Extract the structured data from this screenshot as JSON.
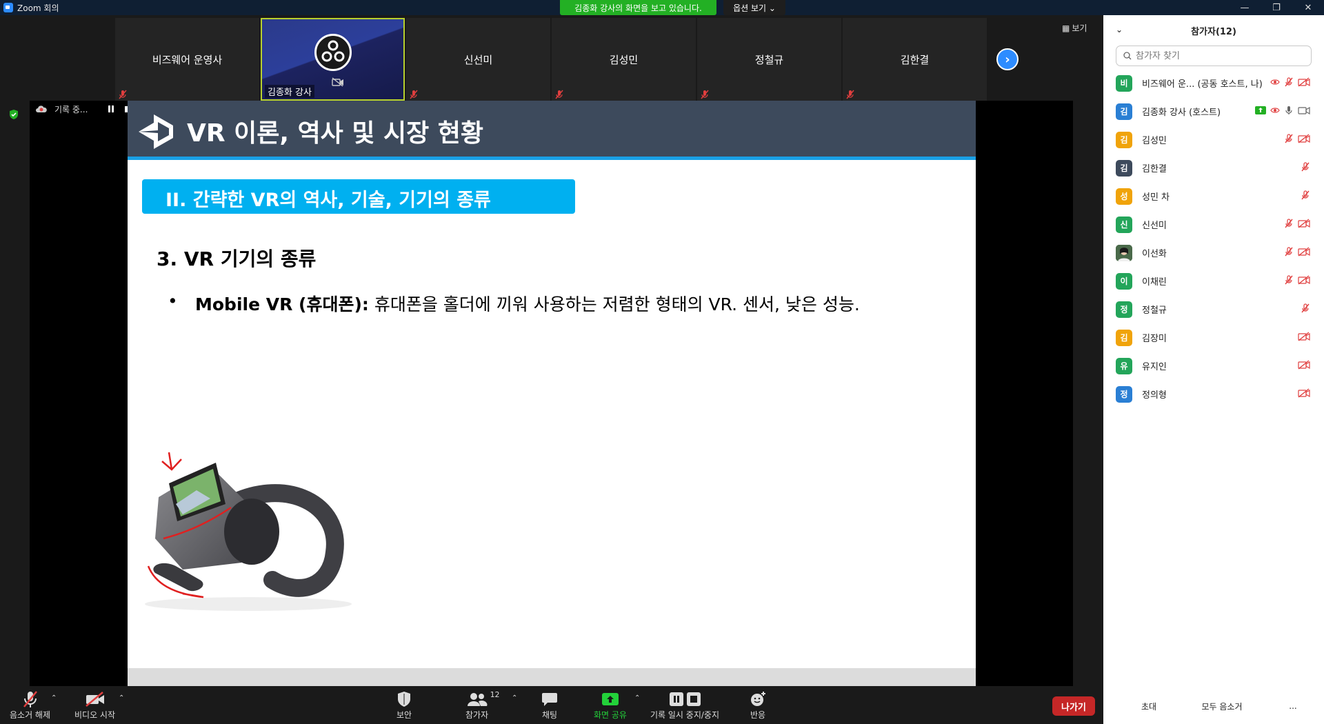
{
  "window": {
    "title": "Zoom 회의",
    "sharing_banner": "김종화 강사의 화면을 보고 있습니다.",
    "view_options": "옵션 보기 ⌄"
  },
  "gallery": {
    "tiles": [
      {
        "name": "비즈웨어 운영사"
      },
      {
        "name": "김종화 강사"
      },
      {
        "name": "신선미"
      },
      {
        "name": "김성민"
      },
      {
        "name": "정철규"
      },
      {
        "name": "김한결"
      }
    ],
    "view_label": "보기"
  },
  "recording": {
    "status": "기록 중..."
  },
  "slide": {
    "title": "VR 이론, 역사 및 시장 현황",
    "section": "II. 간략한 VR의 역사, 기술, 기기의 종류",
    "subheading": "3. VR 기기의 종류",
    "bullet_bold": "Mobile VR (휴대폰):",
    "bullet_text": " 휴대폰을 홀더에 끼워 사용하는 저렴한 형태의 VR. 센서, 낮은 성능."
  },
  "toolbar": {
    "unmute": "음소거 해제",
    "start_video": "비디오 시작",
    "security": "보안",
    "participants": "참가자",
    "participants_count": "12",
    "chat": "채팅",
    "share_screen": "화면 공유",
    "recording_pause": "기록 일시 중지/중지",
    "reactions": "반응",
    "leave": "나가기"
  },
  "panel": {
    "title": "참가자(12)",
    "search_placeholder": "참가자 찾기",
    "participants": [
      {
        "initial": "비",
        "name": "비즈웨어 운... (공동 호스트, 나)",
        "color": "#23a55a"
      },
      {
        "initial": "김",
        "name": "김종화 강사 (호스트)",
        "color": "#2a7fd4"
      },
      {
        "initial": "김",
        "name": "김성민",
        "color": "#f0a30a"
      },
      {
        "initial": "김",
        "name": "김한결",
        "color": "#3d4a5c"
      },
      {
        "initial": "성",
        "name": "성민 차",
        "color": "#f0a30a"
      },
      {
        "initial": "신",
        "name": "신선미",
        "color": "#23a55a"
      },
      {
        "initial": "",
        "name": "이선화",
        "color": "#3a5a3a"
      },
      {
        "initial": "이",
        "name": "이채린",
        "color": "#23a55a"
      },
      {
        "initial": "정",
        "name": "정철규",
        "color": "#23a55a"
      },
      {
        "initial": "김",
        "name": "김장미",
        "color": "#f0a30a"
      },
      {
        "initial": "유",
        "name": "유지인",
        "color": "#23a55a"
      },
      {
        "initial": "정",
        "name": "정의형",
        "color": "#2a7fd4"
      }
    ],
    "invite": "초대",
    "mute_all": "모두 음소거",
    "more": "..."
  }
}
